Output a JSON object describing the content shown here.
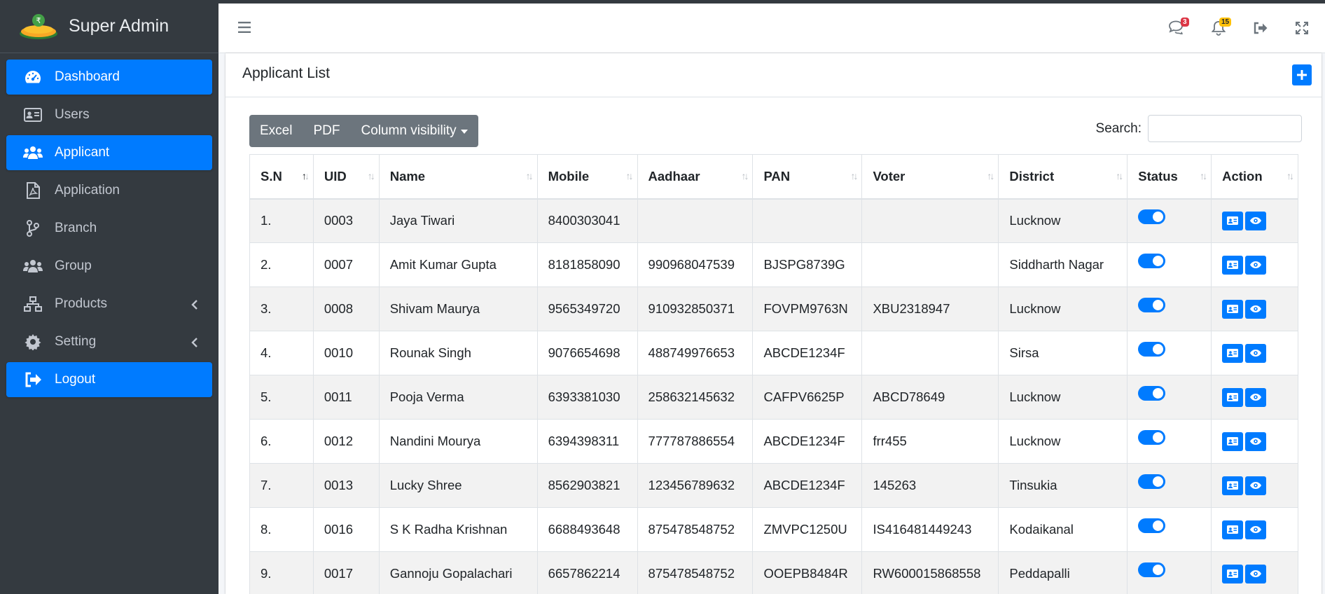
{
  "brand": {
    "title": "Super Admin"
  },
  "sidebar": {
    "items": [
      {
        "label": "Dashboard",
        "icon": "tachometer-icon"
      },
      {
        "label": "Users",
        "icon": "id-card-icon"
      },
      {
        "label": "Applicant",
        "icon": "users-icon"
      },
      {
        "label": "Application",
        "icon": "file-pdf-icon"
      },
      {
        "label": "Branch",
        "icon": "code-branch-icon"
      },
      {
        "label": "Group",
        "icon": "users-icon"
      },
      {
        "label": "Products",
        "icon": "sitemap-icon"
      },
      {
        "label": "Setting",
        "icon": "gear-icon"
      },
      {
        "label": "Logout",
        "icon": "sign-out-icon"
      }
    ]
  },
  "header": {
    "messages_count": "3",
    "notifications_count": "15"
  },
  "page": {
    "title": "Applicant List",
    "buttons": {
      "excel": "Excel",
      "pdf": "PDF",
      "column_visibility": "Column visibility"
    },
    "search": {
      "label": "Search:",
      "value": ""
    }
  },
  "table": {
    "columns": [
      "S.N",
      "UID",
      "Name",
      "Mobile",
      "Aadhaar",
      "PAN",
      "Voter",
      "District",
      "Status",
      "Action"
    ],
    "rows": [
      {
        "sn": "1.",
        "uid": "0003",
        "name": "Jaya Tiwari",
        "mobile": "8400303041",
        "aadhaar": "",
        "pan": "",
        "voter": "",
        "district": "Lucknow",
        "status": true
      },
      {
        "sn": "2.",
        "uid": "0007",
        "name": "Amit Kumar Gupta",
        "mobile": "8181858090",
        "aadhaar": "990968047539",
        "pan": "BJSPG8739G",
        "voter": "",
        "district": "Siddharth Nagar",
        "status": true
      },
      {
        "sn": "3.",
        "uid": "0008",
        "name": "Shivam Maurya",
        "mobile": "9565349720",
        "aadhaar": "910932850371",
        "pan": "FOVPM9763N",
        "voter": "XBU2318947",
        "district": "Lucknow",
        "status": true
      },
      {
        "sn": "4.",
        "uid": "0010",
        "name": "Rounak Singh",
        "mobile": "9076654698",
        "aadhaar": "488749976653",
        "pan": "ABCDE1234F",
        "voter": "",
        "district": "Sirsa",
        "status": true
      },
      {
        "sn": "5.",
        "uid": "0011",
        "name": "Pooja Verma",
        "mobile": "6393381030",
        "aadhaar": "258632145632",
        "pan": "CAFPV6625P",
        "voter": "ABCD78649",
        "district": "Lucknow",
        "status": true
      },
      {
        "sn": "6.",
        "uid": "0012",
        "name": "Nandini Mourya",
        "mobile": "6394398311",
        "aadhaar": "777787886554",
        "pan": "ABCDE1234F",
        "voter": "frr455",
        "district": "Lucknow",
        "status": true
      },
      {
        "sn": "7.",
        "uid": "0013",
        "name": "Lucky Shree",
        "mobile": "8562903821",
        "aadhaar": "123456789632",
        "pan": "ABCDE1234F",
        "voter": "145263",
        "district": "Tinsukia",
        "status": true
      },
      {
        "sn": "8.",
        "uid": "0016",
        "name": "S K Radha Krishnan",
        "mobile": "6688493648",
        "aadhaar": "875478548752",
        "pan": "ZMVPC1250U",
        "voter": "IS416481449243",
        "district": "Kodaikanal",
        "status": true
      },
      {
        "sn": "9.",
        "uid": "0017",
        "name": "Gannoju Gopalachari",
        "mobile": "6657862214",
        "aadhaar": "875478548752",
        "pan": "OOEPB8484R",
        "voter": "RW600015868558",
        "district": "Peddapalli",
        "status": true
      }
    ]
  },
  "colors": {
    "primary": "#007bff",
    "sidebar": "#343a40",
    "button_gray": "#6c757d",
    "badge_red": "#dc3545",
    "badge_yellow": "#ffc107"
  }
}
